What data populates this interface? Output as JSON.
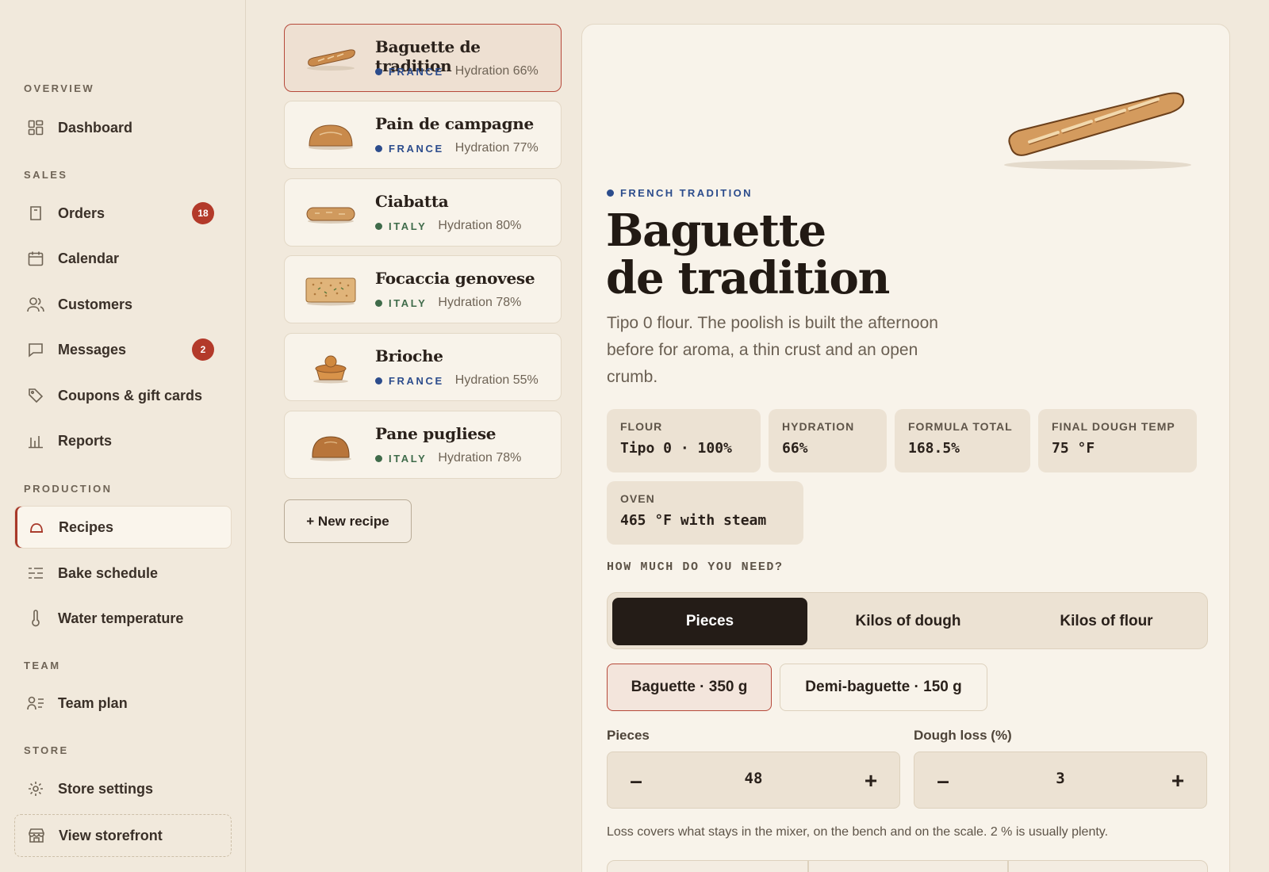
{
  "sidebar": {
    "sections": {
      "overview": "OVERVIEW",
      "sales": "SALES",
      "production": "PRODUCTION",
      "team": "TEAM",
      "store": "STORE"
    },
    "items": {
      "dashboard": {
        "label": "Dashboard",
        "icon": "grid-icon"
      },
      "orders": {
        "label": "Orders",
        "icon": "receipt-icon",
        "badge": "18"
      },
      "calendar": {
        "label": "Calendar",
        "icon": "calendar-icon"
      },
      "customers": {
        "label": "Customers",
        "icon": "users-icon"
      },
      "messages": {
        "label": "Messages",
        "icon": "chat-icon",
        "badge": "2"
      },
      "coupons": {
        "label": "Coupons & gift cards",
        "icon": "tag-icon"
      },
      "reports": {
        "label": "Reports",
        "icon": "bar-chart-icon"
      },
      "recipes": {
        "label": "Recipes",
        "icon": "bread-icon",
        "active": true
      },
      "bake_schedule": {
        "label": "Bake schedule",
        "icon": "list-icon"
      },
      "water_temperature": {
        "label": "Water temperature",
        "icon": "thermometer-icon"
      },
      "team_plan": {
        "label": "Team plan",
        "icon": "team-list-icon"
      },
      "store_settings": {
        "label": "Store settings",
        "icon": "gear-icon"
      },
      "view_storefront": {
        "label": "View storefront",
        "icon": "storefront-icon"
      }
    }
  },
  "recipes": [
    {
      "name": "Baguette de tradition",
      "country": "FRANCE",
      "hydration": "Hydration 66%",
      "selected": true
    },
    {
      "name": "Pain de campagne",
      "country": "FRANCE",
      "hydration": "Hydration 77%"
    },
    {
      "name": "Ciabatta",
      "country": "ITALY",
      "hydration": "Hydration 80%"
    },
    {
      "name": "Focaccia genovese",
      "country": "ITALY",
      "hydration": "Hydration 78%"
    },
    {
      "name": "Brioche",
      "country": "FRANCE",
      "hydration": "Hydration 55%"
    },
    {
      "name": "Pane pugliese",
      "country": "ITALY",
      "hydration": "Hydration 78%"
    }
  ],
  "new_recipe_label": "+ New recipe",
  "colors": {
    "france": "#2c4c8c",
    "italy": "#3f6b4a",
    "accent": "#a8392a",
    "dark": "#241c17"
  },
  "detail": {
    "tag": "FRENCH TRADITION",
    "title_line1": "Baguette",
    "title_line2": "de tradition",
    "description": "Tipo 0 flour. The poolish is built the afternoon before for aroma, a thin crust and an open crumb.",
    "stats": [
      {
        "label": "FLOUR",
        "value": "Tipo 0 · 100%"
      },
      {
        "label": "HYDRATION",
        "value": "66%"
      },
      {
        "label": "FORMULA TOTAL",
        "value": "168.5%"
      },
      {
        "label": "FINAL DOUGH TEMP",
        "value": "75 °F"
      },
      {
        "label": "OVEN",
        "value": "465 °F with steam"
      }
    ],
    "question": "HOW MUCH DO YOU NEED?",
    "modes": [
      "Pieces",
      "Kilos of dough",
      "Kilos of flour"
    ],
    "active_mode": "Pieces",
    "sizes": [
      "Baguette · 350 g",
      "Demi-baguette · 150 g"
    ],
    "active_size": "Baguette · 350 g",
    "pieces_label": "Pieces",
    "pieces_value": "48",
    "loss_label": "Dough loss (%)",
    "loss_value": "3",
    "minus": "–",
    "plus": "+",
    "hint": "Loss covers what stays in the mixer, on the bench and on the scale. 2 % is usually plenty."
  }
}
